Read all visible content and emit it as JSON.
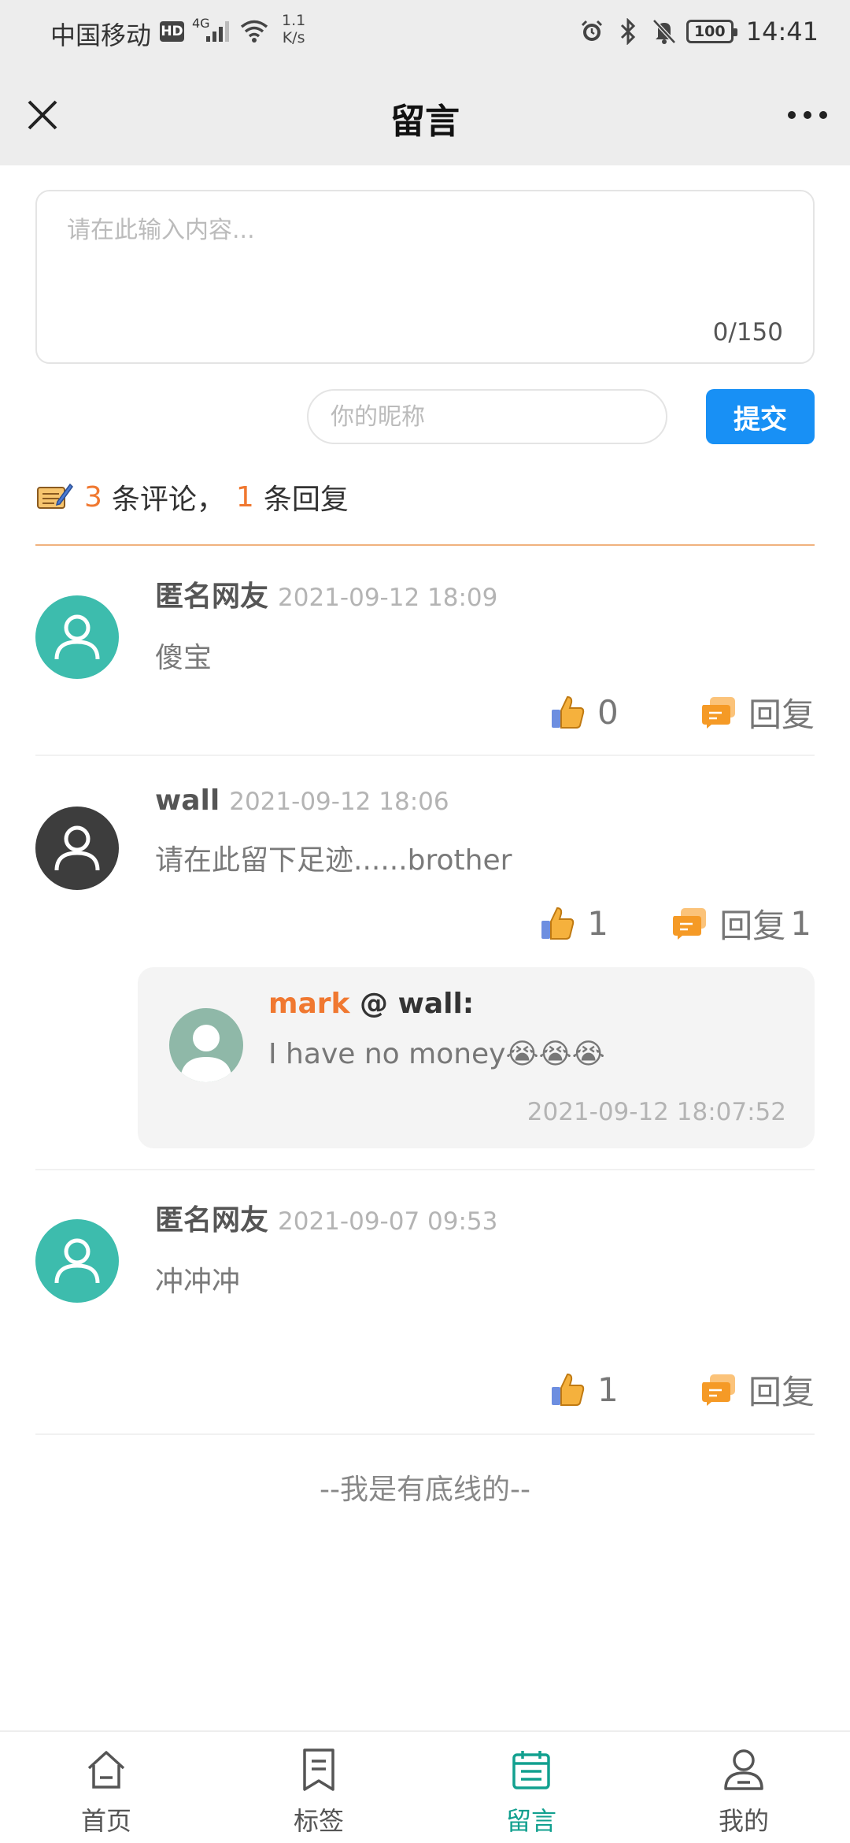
{
  "status_bar": {
    "carrier": "中国移动",
    "hd_badge": "HD",
    "network": "4G",
    "speed_value": "1.1",
    "speed_unit": "K/s",
    "battery": "100",
    "time": "14:41"
  },
  "header": {
    "title": "留言"
  },
  "form": {
    "message_placeholder": "请在此输入内容...",
    "counter": "0/150",
    "nickname_placeholder": "你的昵称",
    "submit_label": "提交"
  },
  "stats": {
    "comment_count": "3",
    "comment_suffix": "条评论，",
    "reply_count": "1",
    "reply_suffix": "条回复"
  },
  "comments": [
    {
      "name": "匿名网友",
      "time": "2021-09-12 18:09",
      "text": "傻宝",
      "likes": "0",
      "reply_label": "回复",
      "reply_count": "",
      "avatar_color": "#3dbcad"
    },
    {
      "name": "wall",
      "time": "2021-09-12 18:06",
      "text": "请在此留下足迹......brother",
      "likes": "1",
      "reply_label": "回复",
      "reply_count": "1",
      "avatar_color": "#3d3d3d",
      "reply": {
        "from": "mark",
        "to": "@ wall:",
        "text": "I have no money😭😭😭",
        "time": "2021-09-12 18:07:52",
        "avatar_color": "#8fb8a8"
      }
    },
    {
      "name": "匿名网友",
      "time": "2021-09-07 09:53",
      "text": "冲冲冲",
      "likes": "1",
      "reply_label": "回复",
      "reply_count": "",
      "avatar_color": "#3dbcad"
    }
  ],
  "bottom_note": "--我是有底线的--",
  "tabbar": {
    "tabs": [
      {
        "label": "首页",
        "icon": "home-icon"
      },
      {
        "label": "标签",
        "icon": "bookmark-icon"
      },
      {
        "label": "留言",
        "icon": "message-board-icon",
        "active": true
      },
      {
        "label": "我的",
        "icon": "user-icon"
      }
    ],
    "active_color": "#12a08f"
  },
  "colors": {
    "accent": "#1890f5",
    "highlight": "#f07830"
  }
}
